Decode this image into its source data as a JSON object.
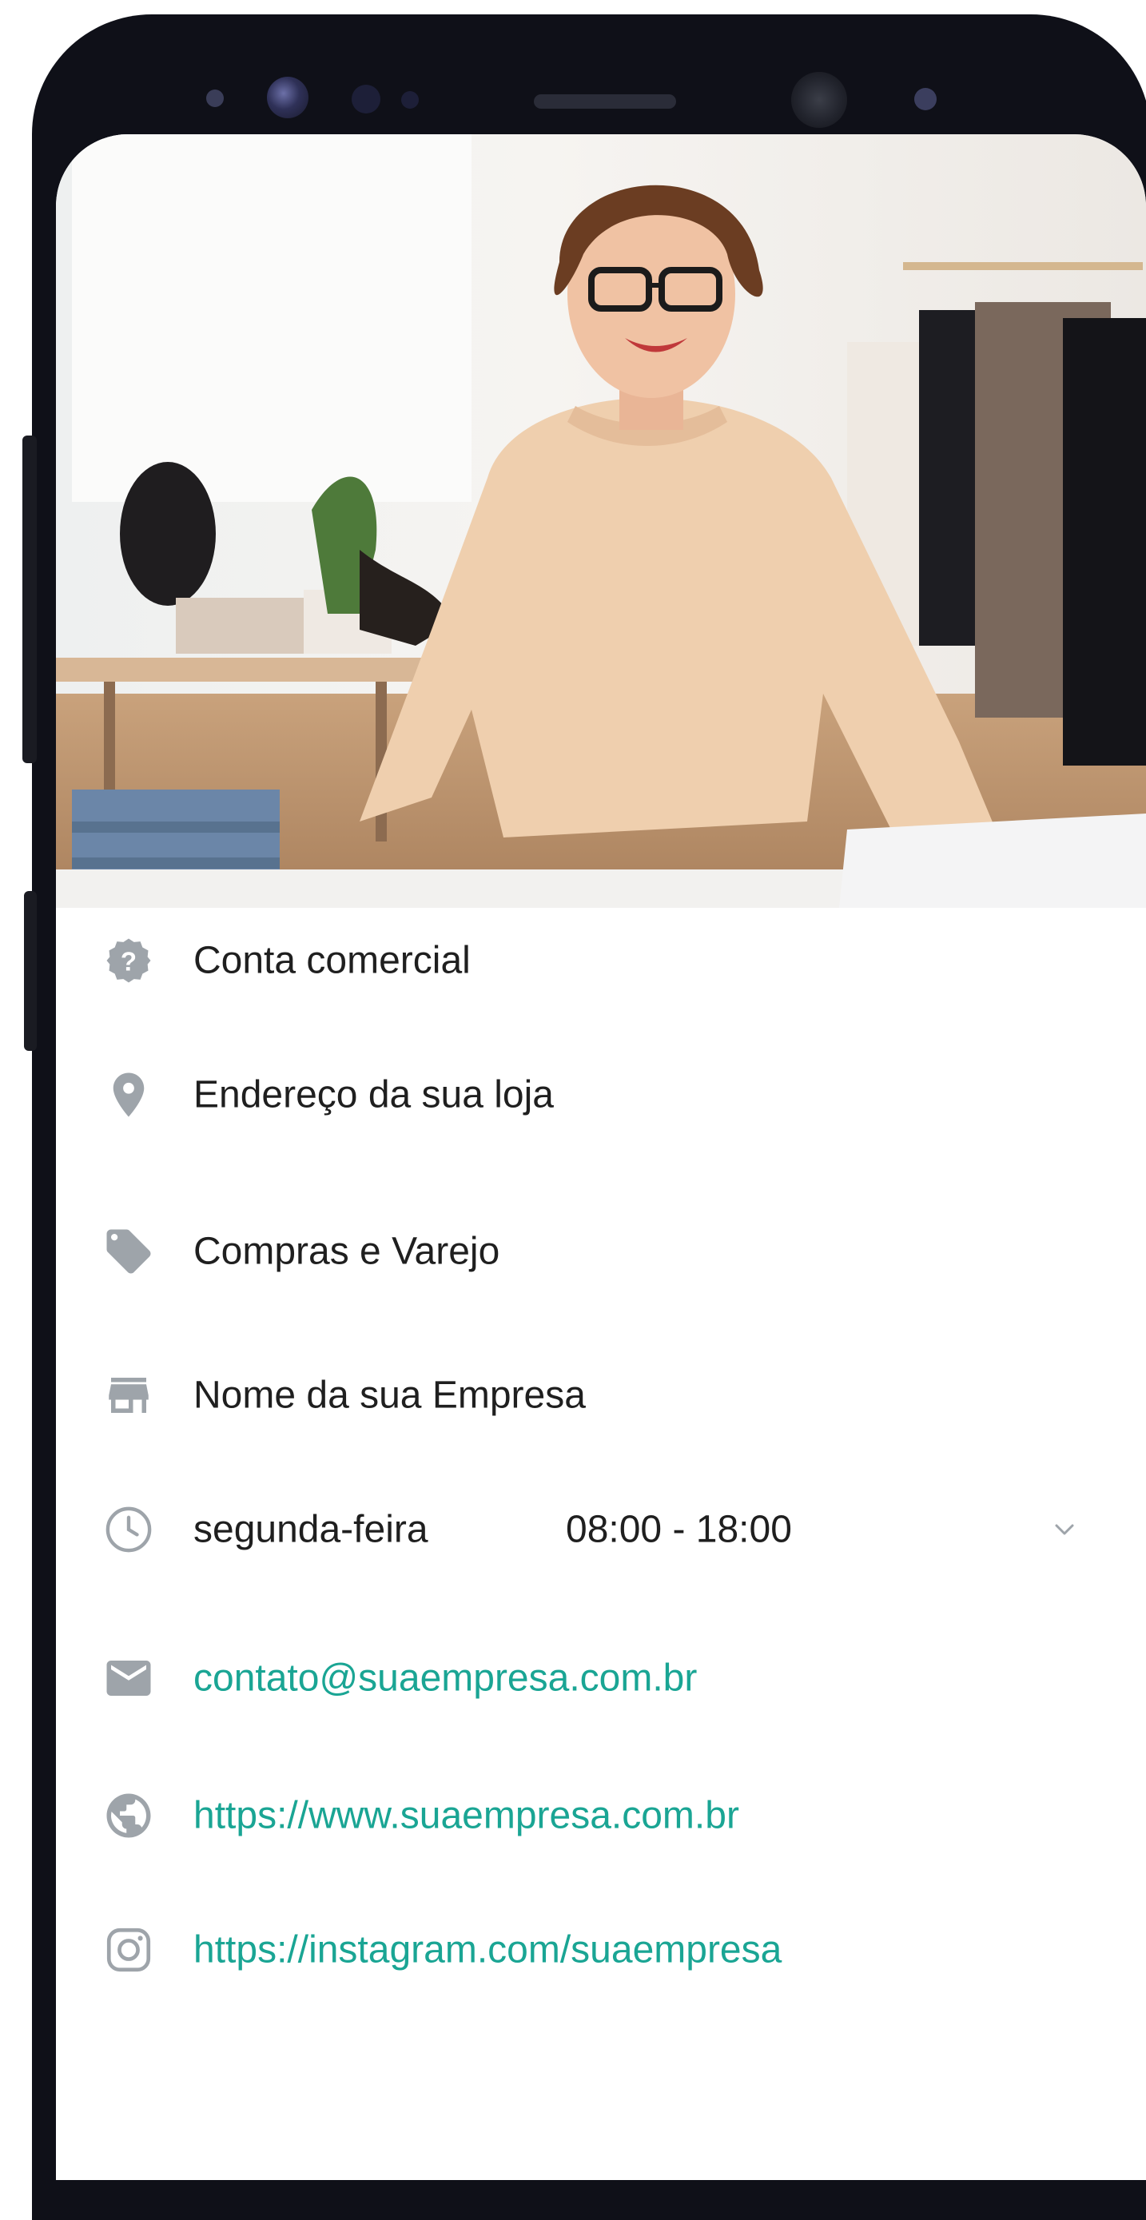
{
  "profile": {
    "items": [
      {
        "icon": "help-icon",
        "label": "Conta comercial"
      },
      {
        "icon": "location-pin-icon",
        "label": "Endereço da sua loja"
      },
      {
        "icon": "tag-icon",
        "label": "Compras e Varejo"
      },
      {
        "icon": "store-icon",
        "label": "Nome da sua Empresa"
      },
      {
        "icon": "clock-icon",
        "label": "segunda-feira",
        "hours": "08:00 - 18:00"
      },
      {
        "icon": "mail-icon",
        "label": "contato@suaempresa.com.br"
      },
      {
        "icon": "globe-icon",
        "label": "https://www.suaempresa.com.br"
      },
      {
        "icon": "instagram-icon",
        "label": "https://instagram.com/suaempresa"
      }
    ]
  },
  "colors": {
    "link": "#1aa594",
    "icon": "#9ea4aa",
    "text": "#1f1f1f",
    "frame": "#0f1018"
  }
}
